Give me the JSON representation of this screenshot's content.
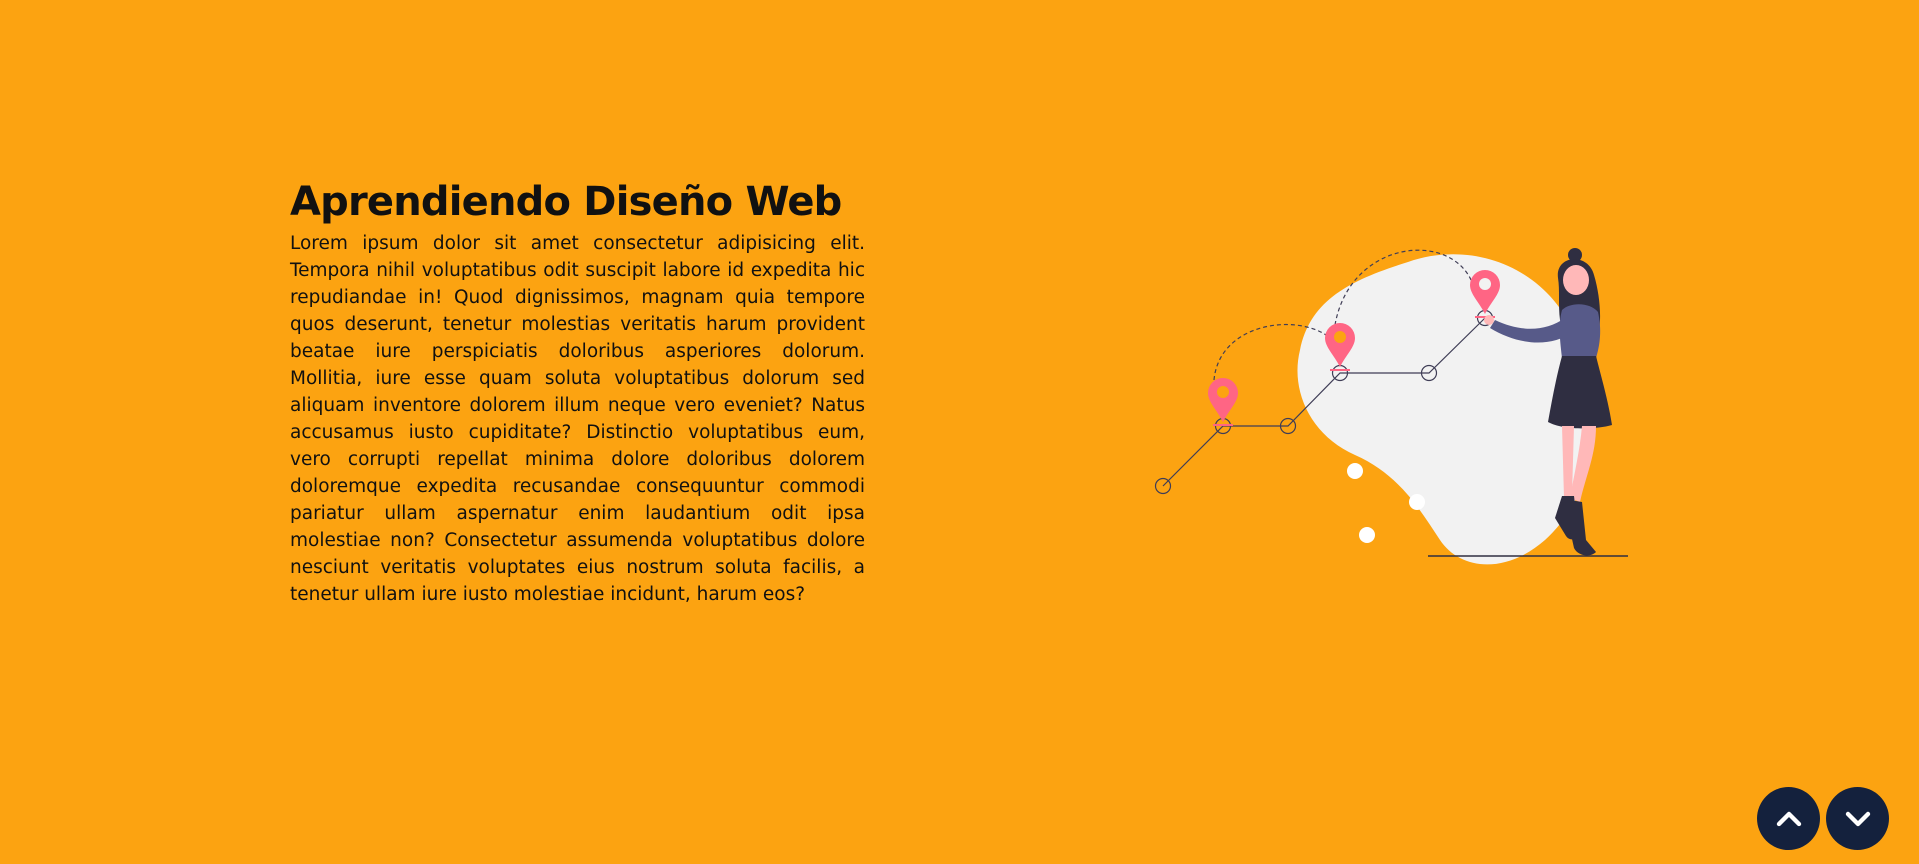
{
  "theme": {
    "background": "#FCA311",
    "nav_button_color": "#14213D",
    "blob_color": "#F2F2F2",
    "pin_color": "#FF6584",
    "outfit_top_color": "#575A89",
    "outfit_skirt_color": "#2F2E41",
    "skin_color": "#FFB8B8",
    "hair_color": "#2F2E41"
  },
  "hero": {
    "title": "Aprendiendo Diseño Web",
    "description": "Lorem ipsum dolor sit amet consectetur adipisicing elit. Tempora nihil voluptatibus odit suscipit labore id expedita hic repudiandae in! Quod dignissimos, magnam quia tempore quos deserunt, tenetur molestias veritatis harum provident beatae iure perspiciatis doloribus asperiores dolorum. Mollitia, iure esse quam soluta voluptatibus dolorum sed aliquam inventore dolorem illum neque vero eveniet? Natus accusamus iusto cupiditate? Distinctio voluptatibus eum, vero corrupti repellat minima dolore doloribus dolorem doloremque expedita recusandae consequuntur commodi pariatur ullam aspernatur enim laudantium odit ipsa molestiae non? Consectetur assumenda voluptatibus dolore nesciunt veritatis voluptates eius nostrum soluta facilis, a tenetur ullam iure iusto molestiae incidunt, harum eos?"
  },
  "illustration": {
    "subject": "woman placing location pins on a route"
  },
  "navigation": {
    "up_icon": "chevron-up-icon",
    "down_icon": "chevron-down-icon"
  }
}
